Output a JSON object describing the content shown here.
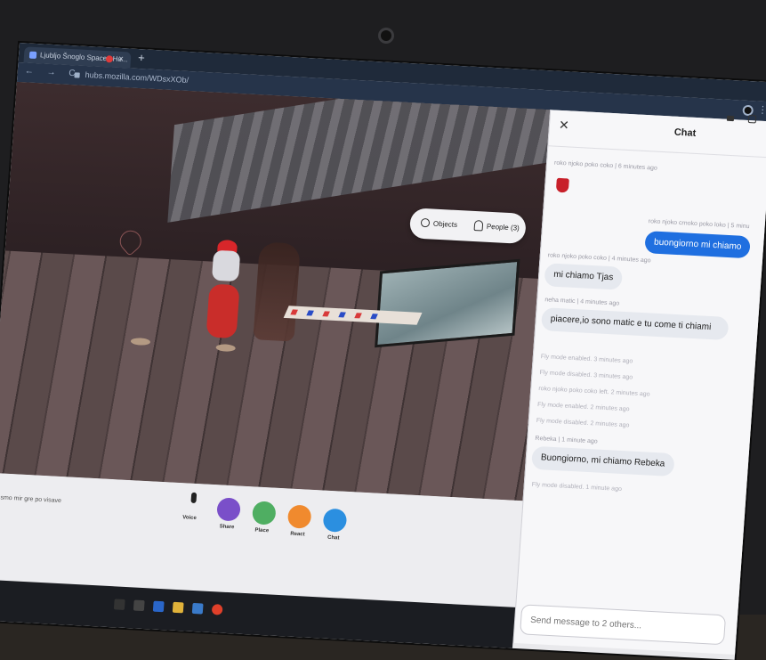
{
  "browser": {
    "tab_title": "Ljubljo Šnoglo Space | Hu...",
    "tab_close": "×",
    "new_tab": "+",
    "url": "hubs.mozilla.com/WDsxXOb/",
    "nav": "← → C"
  },
  "scene": {
    "objects_label": "Objects",
    "people_label": "People (3)"
  },
  "toolbar": {
    "hint": "ro smo mir gre po visave",
    "items": [
      {
        "label": "Voice",
        "color": "#222222"
      },
      {
        "label": "Share",
        "color": "#7a4fc9"
      },
      {
        "label": "Place",
        "color": "#4fae62"
      },
      {
        "label": "React",
        "color": "#f08a2e"
      },
      {
        "label": "Chat",
        "color": "#2b8fe0"
      }
    ]
  },
  "chat": {
    "title": "Chat",
    "messages": [
      {
        "kind": "meta",
        "text": "roko njoko poko coko | 6 minutes ago"
      },
      {
        "kind": "meta-right",
        "text": "roko njoko crnoko poko loko | 5 minu"
      },
      {
        "kind": "out",
        "text": "buongiorno mi chiamo"
      },
      {
        "kind": "meta",
        "text": "roko njoko poko coko | 4 minutes ago"
      },
      {
        "kind": "in",
        "text": "mi chiamo Tjas"
      },
      {
        "kind": "meta",
        "text": "neha matic | 4 minutes ago"
      },
      {
        "kind": "in",
        "text": "piacere,io sono matic e tu come ti chiami"
      },
      {
        "kind": "system",
        "text": "Fly mode enabled.  3 minutes ago"
      },
      {
        "kind": "system",
        "text": "Fly mode disabled.  3 minutes ago"
      },
      {
        "kind": "system",
        "text": "roko njoko poko coko left.  2 minutes ago"
      },
      {
        "kind": "system",
        "text": "Fly mode enabled.  2 minutes ago"
      },
      {
        "kind": "system",
        "text": "Fly mode disabled.  2 minutes ago"
      },
      {
        "kind": "meta",
        "text": "Rebeka | 1 minute ago"
      },
      {
        "kind": "in",
        "text": "Buongiorno, mi chiamo Rebeka"
      },
      {
        "kind": "system",
        "text": "Fly mode disabled.  1 minute ago"
      }
    ],
    "input_placeholder": "Send message to 2 others..."
  },
  "colors": {
    "accent": "#1f6fe0",
    "panel": "#f7f7f9"
  }
}
